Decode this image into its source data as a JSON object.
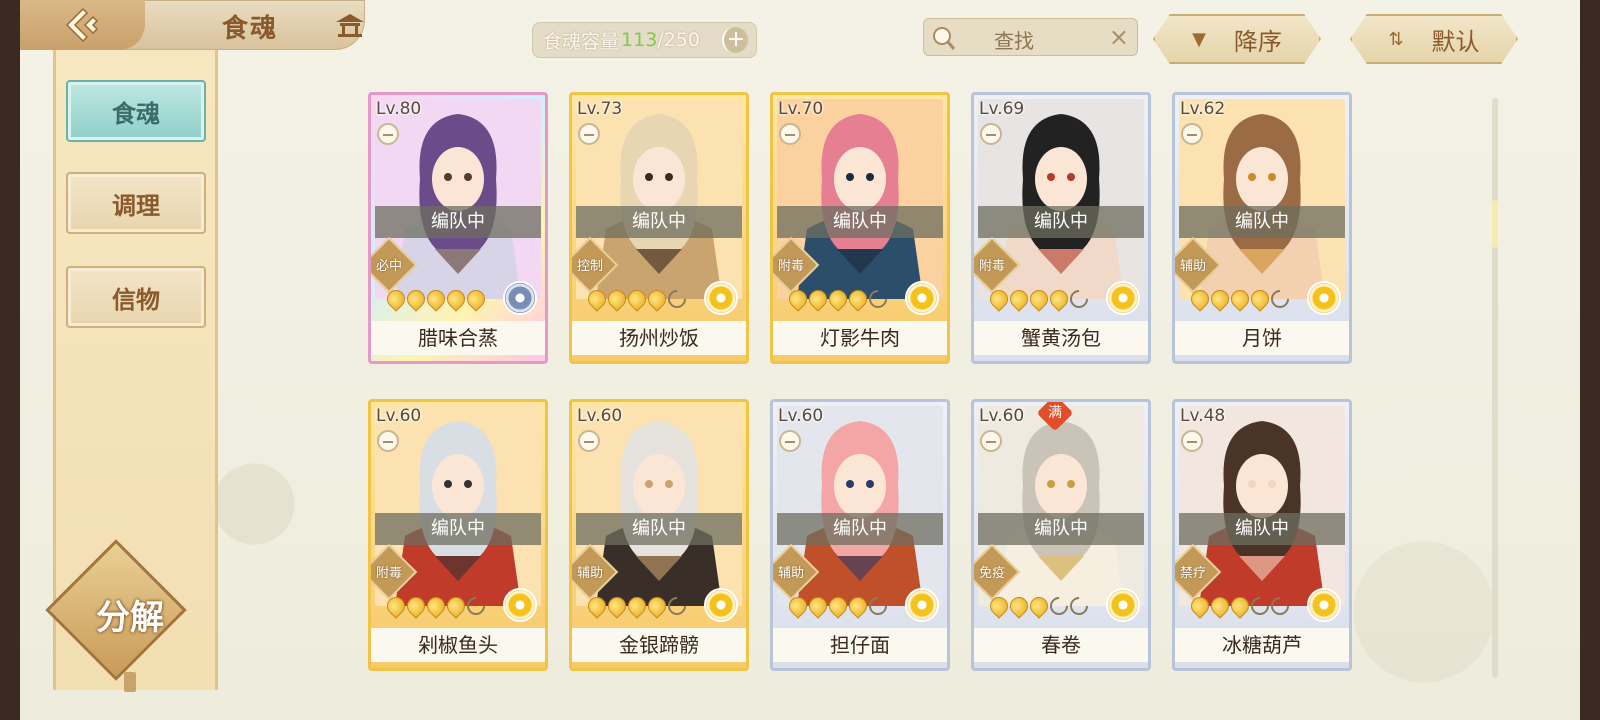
{
  "header": {
    "title": "食魂",
    "capacity_label": "食魂容量",
    "capacity_current": "113",
    "capacity_sep": "/",
    "capacity_max": "250",
    "capacity_add": "+"
  },
  "search": {
    "placeholder": "查找",
    "clear": "×"
  },
  "sort": {
    "order_label": "降序",
    "mode_label": "默认"
  },
  "sidebar": {
    "items": [
      {
        "label": "食魂",
        "active": true
      },
      {
        "label": "调理",
        "active": false
      },
      {
        "label": "信物",
        "active": false
      }
    ],
    "decompose_label": "分解"
  },
  "cards": [
    {
      "level": "Lv.80",
      "name": "腊味合蒸",
      "role": "必中",
      "status": "编队中",
      "stars": 5,
      "max_stars": 5,
      "frame": "rare",
      "flower": "dark",
      "full": ""
    },
    {
      "level": "Lv.73",
      "name": "扬州炒饭",
      "role": "控制",
      "status": "编队中",
      "stars": 4,
      "max_stars": 5,
      "frame": "gold",
      "flower": "gold",
      "full": ""
    },
    {
      "level": "Lv.70",
      "name": "灯影牛肉",
      "role": "附毒",
      "status": "编队中",
      "stars": 4,
      "max_stars": 5,
      "frame": "gold",
      "flower": "gold",
      "full": ""
    },
    {
      "level": "Lv.69",
      "name": "蟹黄汤包",
      "role": "附毒",
      "status": "编队中",
      "stars": 4,
      "max_stars": 5,
      "frame": "silver",
      "flower": "gold",
      "full": ""
    },
    {
      "level": "Lv.62",
      "name": "月饼",
      "role": "辅助",
      "status": "编队中",
      "stars": 4,
      "max_stars": 5,
      "frame": "silver",
      "flower": "gold",
      "full": ""
    },
    {
      "level": "Lv.60",
      "name": "剁椒鱼头",
      "role": "附毒",
      "status": "编队中",
      "stars": 4,
      "max_stars": 5,
      "frame": "gold",
      "flower": "gold",
      "full": ""
    },
    {
      "level": "Lv.60",
      "name": "金银蹄髈",
      "role": "辅助",
      "status": "编队中",
      "stars": 4,
      "max_stars": 5,
      "frame": "gold",
      "flower": "gold",
      "full": ""
    },
    {
      "level": "Lv.60",
      "name": "担仔面",
      "role": "辅助",
      "status": "编队中",
      "stars": 4,
      "max_stars": 5,
      "frame": "silver",
      "flower": "gold",
      "full": ""
    },
    {
      "level": "Lv.60",
      "name": "春卷",
      "role": "免疫",
      "status": "编队中",
      "stars": 3,
      "max_stars": 5,
      "frame": "silver",
      "flower": "gold",
      "full": "满"
    },
    {
      "level": "Lv.48",
      "name": "冰糖葫芦",
      "role": "禁疗",
      "status": "编队中",
      "stars": 3,
      "max_stars": 5,
      "frame": "silver",
      "flower": "gold",
      "full": ""
    }
  ],
  "colors": {
    "accent_teal": "#8fcfc8",
    "gold_frame": "#f0c447",
    "text_brown": "#8a5a2c"
  }
}
